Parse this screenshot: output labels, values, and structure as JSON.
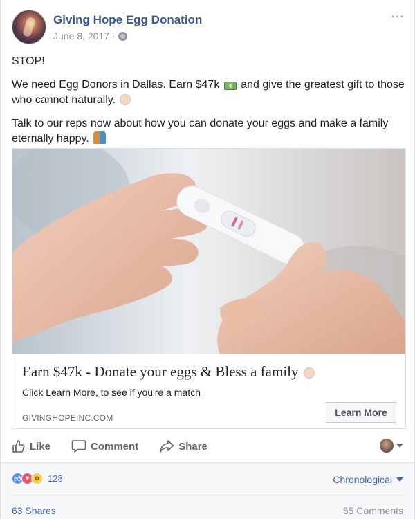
{
  "post": {
    "page_name": "Giving Hope Egg Donation",
    "date": "June 8, 2017",
    "separator": "·",
    "more_icon": "more-horizontal-icon",
    "privacy_icon": "globe-icon",
    "paragraphs": {
      "p1": "STOP!",
      "p2_a": "We need Egg Donors in Dallas. Earn $47k",
      "p2_b": " and give the greatest gift to those who cannot naturally.",
      "p3": "Talk to our reps now about how you can donate your eggs and make a family eternally happy."
    }
  },
  "link_preview": {
    "image_icon": "pregnancy-test-photo",
    "title": "Earn $47k - Donate your eggs & Bless a family",
    "description": "Click Learn More, to see if you're a match",
    "domain": "GIVINGHOPEINC.COM",
    "cta": "Learn More"
  },
  "actions": {
    "like": "Like",
    "comment": "Comment",
    "share": "Share"
  },
  "engagement": {
    "reaction_count": "128",
    "sort": "Chronological",
    "shares": "63 Shares",
    "comments": "55 Comments"
  },
  "colors": {
    "link_blue": "#365899",
    "meta_gray": "#90949c",
    "like_blue": "#5890ff",
    "love_red": "#f25268",
    "wow_yellow": "#fbcd4a"
  }
}
